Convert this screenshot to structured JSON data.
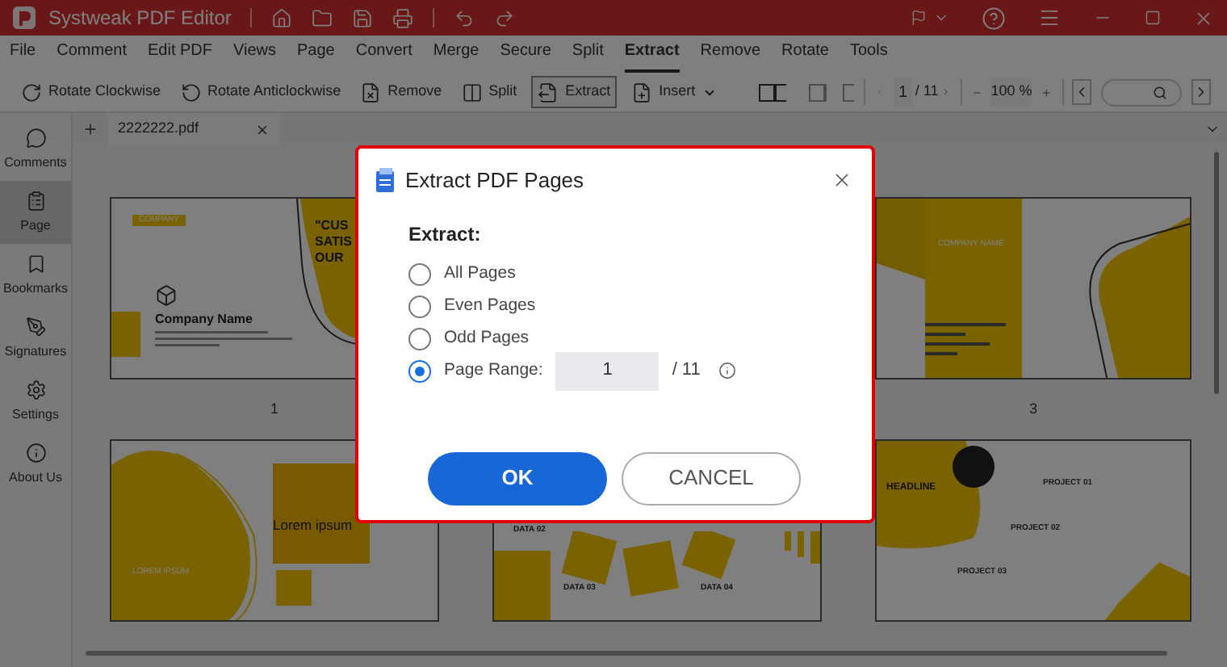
{
  "window": {
    "title": "Systweak PDF Editor"
  },
  "menu": [
    {
      "label": "File",
      "selected": false
    },
    {
      "label": "Comment",
      "selected": false
    },
    {
      "label": "Edit PDF",
      "selected": false
    },
    {
      "label": "Views",
      "selected": false
    },
    {
      "label": "Page",
      "selected": false
    },
    {
      "label": "Convert",
      "selected": false
    },
    {
      "label": "Merge",
      "selected": false
    },
    {
      "label": "Secure",
      "selected": false
    },
    {
      "label": "Split",
      "selected": false
    },
    {
      "label": "Extract",
      "selected": true
    },
    {
      "label": "Remove",
      "selected": false
    },
    {
      "label": "Rotate",
      "selected": false
    },
    {
      "label": "Tools",
      "selected": false
    }
  ],
  "toolbar": [
    {
      "label": "Rotate Clockwise",
      "selected": false,
      "kind": "rotate-cw"
    },
    {
      "label": "Rotate Anticlockwise",
      "selected": false,
      "kind": "rotate-ccw"
    },
    {
      "label": "Remove",
      "selected": false,
      "kind": "remove"
    },
    {
      "label": "Split",
      "selected": false,
      "kind": "split"
    },
    {
      "label": "Extract",
      "selected": true,
      "kind": "extract"
    },
    {
      "label": "Insert",
      "selected": false,
      "kind": "insert"
    }
  ],
  "page_nav": {
    "page": "1",
    "total": "/ 11",
    "zoom": "100 %"
  },
  "sidebar": [
    {
      "label": "Comments",
      "selected": false,
      "kind": "comments"
    },
    {
      "label": "Page",
      "selected": true,
      "kind": "page"
    },
    {
      "label": "Bookmarks",
      "selected": false,
      "kind": "bookmarks"
    },
    {
      "label": "Signatures",
      "selected": false,
      "kind": "signatures"
    },
    {
      "label": "Settings",
      "selected": false,
      "kind": "settings"
    },
    {
      "label": "About Us",
      "selected": false,
      "kind": "about"
    }
  ],
  "tab": {
    "label": "2222222.pdf"
  },
  "pages": [
    {
      "kind": "cover",
      "number": "1",
      "texts": [
        "COMPANY",
        "\"CUS",
        "SATIS",
        "OUR",
        "Company Name"
      ]
    },
    {
      "kind": "hidden"
    },
    {
      "kind": "brochure",
      "number": "3",
      "texts": [
        "COMPANY NAME"
      ]
    },
    {
      "kind": "lorem",
      "texts": [
        "Lorem ipsum",
        "LOREM IPSUM"
      ]
    },
    {
      "kind": "data",
      "texts": [
        "DATA 02",
        "DATA 03",
        "DATA 04"
      ]
    },
    {
      "kind": "projects",
      "texts": [
        "HEADLINE",
        "PROJECT 01",
        "PROJECT 02",
        "PROJECT 03"
      ]
    }
  ],
  "dialog": {
    "title": "Extract PDF Pages",
    "heading": "Extract:",
    "options": [
      {
        "label": "All Pages",
        "selected": false,
        "kind": "plain"
      },
      {
        "label": "Even Pages",
        "selected": false,
        "kind": "plain"
      },
      {
        "label": "Odd Pages",
        "selected": false,
        "kind": "plain"
      },
      {
        "label": "Page Range:",
        "selected": true,
        "kind": "range"
      }
    ],
    "range_value": "1",
    "range_total": "/ 11",
    "buttons": [
      {
        "label": "OK",
        "kind": "primary"
      },
      {
        "label": "CANCEL",
        "kind": "secondary"
      }
    ]
  }
}
